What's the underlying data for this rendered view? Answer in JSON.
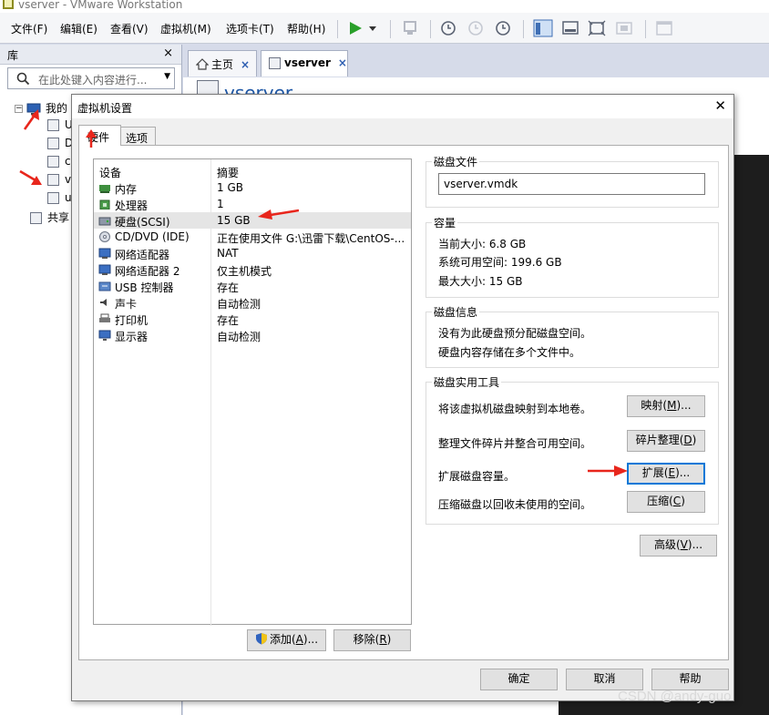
{
  "app": {
    "window_title": "vserver - VMware Workstation",
    "menu": [
      "文件(F)",
      "编辑(E)",
      "查看(V)",
      "虚拟机(M)",
      "选项卡(T)",
      "帮助(H)"
    ]
  },
  "library": {
    "title": "库",
    "close": "×",
    "search_placeholder": "在此处键入内容进行...",
    "root_label": "我的",
    "vm_items": [
      "U",
      "D",
      "c",
      "v",
      "u"
    ],
    "shared_label": "共享"
  },
  "document_tabs": {
    "home_label": "主页",
    "vm_label": "vserver",
    "close": "×"
  },
  "vm_heading": "vserver",
  "dialog": {
    "title": "虚拟机设置",
    "close": "✕",
    "tabs": {
      "hardware": "硬件",
      "options": "选项"
    },
    "columns": {
      "device": "设备",
      "summary": "摘要"
    },
    "devices": [
      {
        "name": "内存",
        "summary": "1 GB",
        "icon": "memory-icon"
      },
      {
        "name": "处理器",
        "summary": "1",
        "icon": "processor-icon"
      },
      {
        "name": "硬盘(SCSI)",
        "summary": "15 GB",
        "icon": "hard-disk-icon",
        "selected": true
      },
      {
        "name": "CD/DVD (IDE)",
        "summary": "正在使用文件 G:\\迅雷下载\\CentOS-...",
        "icon": "cd-dvd-icon"
      },
      {
        "name": "网络适配器",
        "summary": "NAT",
        "icon": "network-adapter-icon"
      },
      {
        "name": "网络适配器 2",
        "summary": "仅主机模式",
        "icon": "network-adapter-icon"
      },
      {
        "name": "USB 控制器",
        "summary": "存在",
        "icon": "usb-icon"
      },
      {
        "name": "声卡",
        "summary": "自动检测",
        "icon": "sound-card-icon"
      },
      {
        "name": "打印机",
        "summary": "存在",
        "icon": "printer-icon"
      },
      {
        "name": "显示器",
        "summary": "自动检测",
        "icon": "display-icon"
      }
    ],
    "add_button": {
      "text": "添加(",
      "key": "A",
      "tail": ")..."
    },
    "remove_button": {
      "text": "移除(",
      "key": "R",
      "tail": ")"
    },
    "disk_file": {
      "title": "磁盘文件",
      "value": "vserver.vmdk"
    },
    "capacity": {
      "title": "容量",
      "current_size": "当前大小: 6.8 GB",
      "system_free": "系统可用空间: 199.6 GB",
      "max_size": "最大大小: 15 GB"
    },
    "disk_info": {
      "title": "磁盘信息",
      "line1": "没有为此硬盘预分配磁盘空间。",
      "line2": "硬盘内容存储在多个文件中。"
    },
    "utilities": {
      "title": "磁盘实用工具",
      "map_desc": "将该虚拟机磁盘映射到本地卷。",
      "map_button": {
        "text": "映射(",
        "key": "M",
        "tail": ")..."
      },
      "defrag_desc": "整理文件碎片并整合可用空间。",
      "defrag_button": {
        "text": "碎片整理(",
        "key": "D",
        "tail": ")"
      },
      "expand_desc": "扩展磁盘容量。",
      "expand_button": {
        "text": "扩展(",
        "key": "E",
        "tail": ")..."
      },
      "compact_desc": "压缩磁盘以回收未使用的空间。",
      "compact_button": {
        "text": "压缩(",
        "key": "C",
        "tail": ")"
      }
    },
    "advanced_button": {
      "text": "高级(",
      "key": "V",
      "tail": ")..."
    },
    "ok_button": "确定",
    "cancel_button": "取消",
    "help_button": "帮助"
  },
  "watermark": "CSDN @andy-guo",
  "colors": {
    "annotation_arrow": "#e8261c",
    "accent": "#1d57a7",
    "play": "#2aa02a"
  }
}
